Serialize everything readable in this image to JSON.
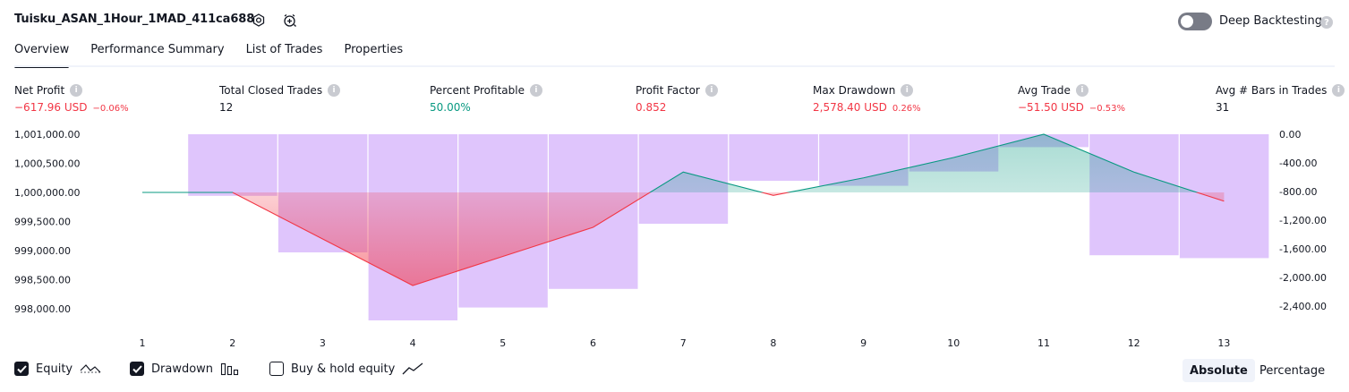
{
  "header": {
    "strategy_name": "Tuisku_ASAN_1Hour_1MAD_411ca688",
    "deep_backtesting_label": "Deep Backtesting",
    "deep_backtesting_enabled": false,
    "icons": [
      "settings-icon",
      "alarm-add-icon",
      "help-icon"
    ]
  },
  "tabs": [
    {
      "label": "Overview",
      "active": true
    },
    {
      "label": "Performance Summary",
      "active": false
    },
    {
      "label": "List of Trades",
      "active": false
    },
    {
      "label": "Properties",
      "active": false
    }
  ],
  "metrics": [
    {
      "label": "Net Profit",
      "value": "−617.96 USD",
      "pct": "−0.06%",
      "status": "neg"
    },
    {
      "label": "Total Closed Trades",
      "value": "12",
      "pct": "",
      "status": "neu"
    },
    {
      "label": "Percent Profitable",
      "value": "50.00%",
      "pct": "",
      "status": "pos"
    },
    {
      "label": "Profit Factor",
      "value": "0.852",
      "pct": "",
      "status": "neg"
    },
    {
      "label": "Max Drawdown",
      "value": "2,578.40 USD",
      "pct": "0.26%",
      "status": "neg"
    },
    {
      "label": "Avg Trade",
      "value": "−51.50 USD",
      "pct": "−0.53%",
      "status": "neg"
    },
    {
      "label": "Avg # Bars in Trades",
      "value": "31",
      "pct": "",
      "status": "neu"
    }
  ],
  "colors": {
    "negative": "#f23645",
    "positive": "#089981",
    "drawdown_bar": "#d9bbfc",
    "text": "#131722"
  },
  "chart_data": {
    "type": "line",
    "x": [
      1,
      2,
      3,
      4,
      5,
      6,
      7,
      8,
      9,
      10,
      11,
      12,
      13
    ],
    "left_ticks": [
      "1,001,000.00",
      "1,000,500.00",
      "1,000,000.00",
      "999,500.00",
      "999,000.00",
      "998,500.00",
      "998,000.00"
    ],
    "left_tick_values": [
      1001000,
      1000500,
      1000000,
      999500,
      999000,
      998500,
      998000
    ],
    "right_ticks": [
      "0.00",
      "-400.00",
      "-800.00",
      "-1,200.00",
      "-1,600.00",
      "-2,000.00",
      "-2,400.00"
    ],
    "right_tick_values": [
      0,
      -400,
      -800,
      -1200,
      -1600,
      -2000,
      -2400
    ],
    "ylim_equity": [
      997800,
      1001000
    ],
    "ylim_drawdown": [
      -2600,
      0
    ],
    "series": [
      {
        "name": "Equity",
        "axis": "left",
        "baseline": 1000000,
        "values": [
          1000000,
          1000000,
          999200,
          998400,
          998900,
          999400,
          1000350,
          999950,
          1000250,
          1000600,
          1001000,
          1000350,
          999850
        ]
      },
      {
        "name": "Drawdown",
        "axis": "right",
        "type": "bar",
        "values": [
          0,
          -860,
          -1650,
          -2600,
          -2420,
          -2160,
          -1250,
          -650,
          -720,
          -520,
          -180,
          -1690,
          -1730
        ]
      }
    ],
    "grid": false,
    "legend": [
      {
        "label": "Equity",
        "checked": true,
        "icon": "equity-line-icon"
      },
      {
        "label": "Drawdown",
        "checked": true,
        "icon": "drawdown-bars-icon"
      },
      {
        "label": "Buy & hold equity",
        "checked": false,
        "icon": "buy-hold-line-icon"
      }
    ]
  },
  "scale_buttons": [
    {
      "label": "Absolute",
      "active": true
    },
    {
      "label": "Percentage",
      "active": false
    }
  ]
}
